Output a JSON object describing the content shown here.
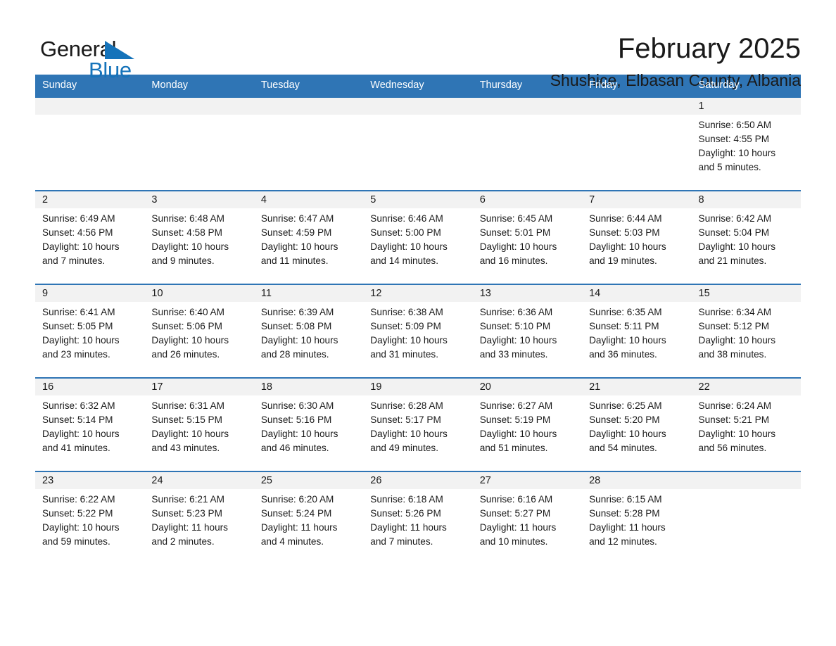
{
  "brand": {
    "name_dark": "General",
    "name_blue": "Blue",
    "color_blue": "#1573ba"
  },
  "header": {
    "month_title": "February 2025",
    "location": "Shushice, Elbasan County, Albania"
  },
  "theme": {
    "header_row_bg": "#2f75b5",
    "daynum_bg": "#f2f2f2",
    "cell_bg": "#ffffff",
    "text": "#1a1a1a"
  },
  "calendar": {
    "weekday_headers": [
      "Sunday",
      "Monday",
      "Tuesday",
      "Wednesday",
      "Thursday",
      "Friday",
      "Saturday"
    ],
    "labels": {
      "sunrise": "Sunrise:",
      "sunset": "Sunset:",
      "daylight": "Daylight:"
    },
    "weeks": [
      [
        {
          "day": "",
          "sunrise": "",
          "sunset": "",
          "daylight_1": "",
          "daylight_2": ""
        },
        {
          "day": "",
          "sunrise": "",
          "sunset": "",
          "daylight_1": "",
          "daylight_2": ""
        },
        {
          "day": "",
          "sunrise": "",
          "sunset": "",
          "daylight_1": "",
          "daylight_2": ""
        },
        {
          "day": "",
          "sunrise": "",
          "sunset": "",
          "daylight_1": "",
          "daylight_2": ""
        },
        {
          "day": "",
          "sunrise": "",
          "sunset": "",
          "daylight_1": "",
          "daylight_2": ""
        },
        {
          "day": "",
          "sunrise": "",
          "sunset": "",
          "daylight_1": "",
          "daylight_2": ""
        },
        {
          "day": "1",
          "sunrise": "Sunrise: 6:50 AM",
          "sunset": "Sunset: 4:55 PM",
          "daylight_1": "Daylight: 10 hours",
          "daylight_2": "and 5 minutes."
        }
      ],
      [
        {
          "day": "2",
          "sunrise": "Sunrise: 6:49 AM",
          "sunset": "Sunset: 4:56 PM",
          "daylight_1": "Daylight: 10 hours",
          "daylight_2": "and 7 minutes."
        },
        {
          "day": "3",
          "sunrise": "Sunrise: 6:48 AM",
          "sunset": "Sunset: 4:58 PM",
          "daylight_1": "Daylight: 10 hours",
          "daylight_2": "and 9 minutes."
        },
        {
          "day": "4",
          "sunrise": "Sunrise: 6:47 AM",
          "sunset": "Sunset: 4:59 PM",
          "daylight_1": "Daylight: 10 hours",
          "daylight_2": "and 11 minutes."
        },
        {
          "day": "5",
          "sunrise": "Sunrise: 6:46 AM",
          "sunset": "Sunset: 5:00 PM",
          "daylight_1": "Daylight: 10 hours",
          "daylight_2": "and 14 minutes."
        },
        {
          "day": "6",
          "sunrise": "Sunrise: 6:45 AM",
          "sunset": "Sunset: 5:01 PM",
          "daylight_1": "Daylight: 10 hours",
          "daylight_2": "and 16 minutes."
        },
        {
          "day": "7",
          "sunrise": "Sunrise: 6:44 AM",
          "sunset": "Sunset: 5:03 PM",
          "daylight_1": "Daylight: 10 hours",
          "daylight_2": "and 19 minutes."
        },
        {
          "day": "8",
          "sunrise": "Sunrise: 6:42 AM",
          "sunset": "Sunset: 5:04 PM",
          "daylight_1": "Daylight: 10 hours",
          "daylight_2": "and 21 minutes."
        }
      ],
      [
        {
          "day": "9",
          "sunrise": "Sunrise: 6:41 AM",
          "sunset": "Sunset: 5:05 PM",
          "daylight_1": "Daylight: 10 hours",
          "daylight_2": "and 23 minutes."
        },
        {
          "day": "10",
          "sunrise": "Sunrise: 6:40 AM",
          "sunset": "Sunset: 5:06 PM",
          "daylight_1": "Daylight: 10 hours",
          "daylight_2": "and 26 minutes."
        },
        {
          "day": "11",
          "sunrise": "Sunrise: 6:39 AM",
          "sunset": "Sunset: 5:08 PM",
          "daylight_1": "Daylight: 10 hours",
          "daylight_2": "and 28 minutes."
        },
        {
          "day": "12",
          "sunrise": "Sunrise: 6:38 AM",
          "sunset": "Sunset: 5:09 PM",
          "daylight_1": "Daylight: 10 hours",
          "daylight_2": "and 31 minutes."
        },
        {
          "day": "13",
          "sunrise": "Sunrise: 6:36 AM",
          "sunset": "Sunset: 5:10 PM",
          "daylight_1": "Daylight: 10 hours",
          "daylight_2": "and 33 minutes."
        },
        {
          "day": "14",
          "sunrise": "Sunrise: 6:35 AM",
          "sunset": "Sunset: 5:11 PM",
          "daylight_1": "Daylight: 10 hours",
          "daylight_2": "and 36 minutes."
        },
        {
          "day": "15",
          "sunrise": "Sunrise: 6:34 AM",
          "sunset": "Sunset: 5:12 PM",
          "daylight_1": "Daylight: 10 hours",
          "daylight_2": "and 38 minutes."
        }
      ],
      [
        {
          "day": "16",
          "sunrise": "Sunrise: 6:32 AM",
          "sunset": "Sunset: 5:14 PM",
          "daylight_1": "Daylight: 10 hours",
          "daylight_2": "and 41 minutes."
        },
        {
          "day": "17",
          "sunrise": "Sunrise: 6:31 AM",
          "sunset": "Sunset: 5:15 PM",
          "daylight_1": "Daylight: 10 hours",
          "daylight_2": "and 43 minutes."
        },
        {
          "day": "18",
          "sunrise": "Sunrise: 6:30 AM",
          "sunset": "Sunset: 5:16 PM",
          "daylight_1": "Daylight: 10 hours",
          "daylight_2": "and 46 minutes."
        },
        {
          "day": "19",
          "sunrise": "Sunrise: 6:28 AM",
          "sunset": "Sunset: 5:17 PM",
          "daylight_1": "Daylight: 10 hours",
          "daylight_2": "and 49 minutes."
        },
        {
          "day": "20",
          "sunrise": "Sunrise: 6:27 AM",
          "sunset": "Sunset: 5:19 PM",
          "daylight_1": "Daylight: 10 hours",
          "daylight_2": "and 51 minutes."
        },
        {
          "day": "21",
          "sunrise": "Sunrise: 6:25 AM",
          "sunset": "Sunset: 5:20 PM",
          "daylight_1": "Daylight: 10 hours",
          "daylight_2": "and 54 minutes."
        },
        {
          "day": "22",
          "sunrise": "Sunrise: 6:24 AM",
          "sunset": "Sunset: 5:21 PM",
          "daylight_1": "Daylight: 10 hours",
          "daylight_2": "and 56 minutes."
        }
      ],
      [
        {
          "day": "23",
          "sunrise": "Sunrise: 6:22 AM",
          "sunset": "Sunset: 5:22 PM",
          "daylight_1": "Daylight: 10 hours",
          "daylight_2": "and 59 minutes."
        },
        {
          "day": "24",
          "sunrise": "Sunrise: 6:21 AM",
          "sunset": "Sunset: 5:23 PM",
          "daylight_1": "Daylight: 11 hours",
          "daylight_2": "and 2 minutes."
        },
        {
          "day": "25",
          "sunrise": "Sunrise: 6:20 AM",
          "sunset": "Sunset: 5:24 PM",
          "daylight_1": "Daylight: 11 hours",
          "daylight_2": "and 4 minutes."
        },
        {
          "day": "26",
          "sunrise": "Sunrise: 6:18 AM",
          "sunset": "Sunset: 5:26 PM",
          "daylight_1": "Daylight: 11 hours",
          "daylight_2": "and 7 minutes."
        },
        {
          "day": "27",
          "sunrise": "Sunrise: 6:16 AM",
          "sunset": "Sunset: 5:27 PM",
          "daylight_1": "Daylight: 11 hours",
          "daylight_2": "and 10 minutes."
        },
        {
          "day": "28",
          "sunrise": "Sunrise: 6:15 AM",
          "sunset": "Sunset: 5:28 PM",
          "daylight_1": "Daylight: 11 hours",
          "daylight_2": "and 12 minutes."
        },
        {
          "day": "",
          "sunrise": "",
          "sunset": "",
          "daylight_1": "",
          "daylight_2": ""
        }
      ]
    ]
  }
}
